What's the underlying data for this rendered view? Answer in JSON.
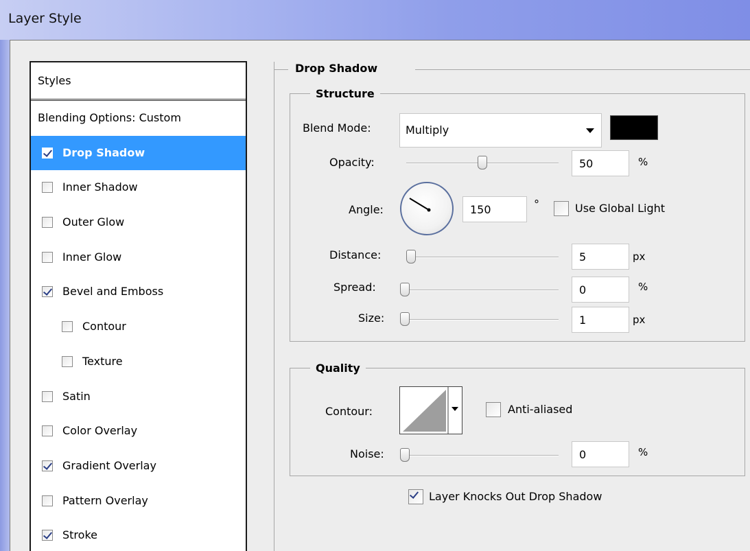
{
  "window": {
    "title": "Layer Style"
  },
  "styles_panel": {
    "header": "Styles",
    "items": [
      {
        "label": "Blending Options: Custom",
        "has_checkbox": false,
        "checked": false,
        "selected": false,
        "indent": false
      },
      {
        "label": "Drop Shadow",
        "has_checkbox": true,
        "checked": true,
        "selected": true,
        "indent": false
      },
      {
        "label": "Inner Shadow",
        "has_checkbox": true,
        "checked": false,
        "selected": false,
        "indent": false
      },
      {
        "label": "Outer Glow",
        "has_checkbox": true,
        "checked": false,
        "selected": false,
        "indent": false
      },
      {
        "label": "Inner Glow",
        "has_checkbox": true,
        "checked": false,
        "selected": false,
        "indent": false
      },
      {
        "label": "Bevel and Emboss",
        "has_checkbox": true,
        "checked": true,
        "selected": false,
        "indent": false
      },
      {
        "label": "Contour",
        "has_checkbox": true,
        "checked": false,
        "selected": false,
        "indent": true
      },
      {
        "label": "Texture",
        "has_checkbox": true,
        "checked": false,
        "selected": false,
        "indent": true
      },
      {
        "label": "Satin",
        "has_checkbox": true,
        "checked": false,
        "selected": false,
        "indent": false
      },
      {
        "label": "Color Overlay",
        "has_checkbox": true,
        "checked": false,
        "selected": false,
        "indent": false
      },
      {
        "label": "Gradient Overlay",
        "has_checkbox": true,
        "checked": true,
        "selected": false,
        "indent": false
      },
      {
        "label": "Pattern Overlay",
        "has_checkbox": true,
        "checked": false,
        "selected": false,
        "indent": false
      },
      {
        "label": "Stroke",
        "has_checkbox": true,
        "checked": true,
        "selected": false,
        "indent": false
      }
    ]
  },
  "drop_shadow": {
    "title": "Drop Shadow",
    "structure": {
      "title": "Structure",
      "blend_mode_label": "Blend Mode:",
      "blend_mode_value": "Multiply",
      "shadow_color": "#000000",
      "opacity_label": "Opacity:",
      "opacity_value": "50",
      "opacity_unit": "%",
      "angle_label": "Angle:",
      "angle_value": "150",
      "angle_unit": "°",
      "use_global_light_label": "Use Global Light",
      "use_global_light_checked": false,
      "distance_label": "Distance:",
      "distance_value": "5",
      "distance_unit": "px",
      "spread_label": "Spread:",
      "spread_value": "0",
      "spread_unit": "%",
      "size_label": "Size:",
      "size_value": "1",
      "size_unit": "px"
    },
    "quality": {
      "title": "Quality",
      "contour_label": "Contour:",
      "anti_aliased_label": "Anti-aliased",
      "anti_aliased_checked": false,
      "noise_label": "Noise:",
      "noise_value": "0",
      "noise_unit": "%"
    },
    "knockout_label": "Layer Knocks Out Drop Shadow",
    "knockout_checked": true
  },
  "colors": {
    "selection": "#3399ff",
    "title_bar": "#8f9eea"
  }
}
